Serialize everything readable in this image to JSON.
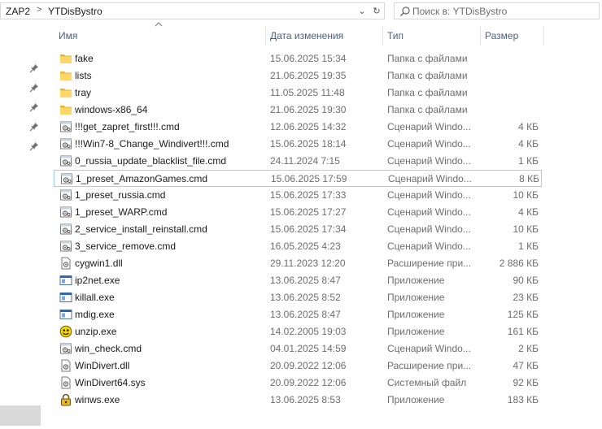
{
  "address": {
    "crumbs": [
      "ZAP2",
      "YTDisBystro"
    ],
    "separator": ">",
    "dropdown_glyph": "⌄",
    "refresh_glyph": "↻"
  },
  "search": {
    "placeholder": "Поиск в: YTDisBystro",
    "icon": "search-icon"
  },
  "columns": {
    "name": "Имя",
    "date": "Дата изменения",
    "type": "Тип",
    "size": "Размер",
    "sorted_by": "name",
    "sort_direction": "ascending"
  },
  "colors": {
    "folder": "#ffd766",
    "folder_dark": "#e8b43a",
    "selection_border": "#99d1ff",
    "header_text": "#4c607a",
    "secondary_text": "#6d6d6d"
  },
  "files": [
    {
      "name": "fake",
      "date": "15.06.2025 15:34",
      "type": "Папка с файлами",
      "size": "",
      "icon": "folder-icon"
    },
    {
      "name": "lists",
      "date": "21.06.2025 19:35",
      "type": "Папка с файлами",
      "size": "",
      "icon": "folder-icon"
    },
    {
      "name": "tray",
      "date": "11.05.2025 11:48",
      "type": "Папка с файлами",
      "size": "",
      "icon": "folder-icon"
    },
    {
      "name": "windows-x86_64",
      "date": "21.06.2025 19:30",
      "type": "Папка с файлами",
      "size": "",
      "icon": "folder-icon"
    },
    {
      "name": "!!!get_zapret_first!!!.cmd",
      "date": "12.06.2025 14:32",
      "type": "Сценарий Windo...",
      "size": "4 КБ",
      "icon": "script-icon"
    },
    {
      "name": "!!!Win7-8_Change_Windivert!!!.cmd",
      "date": "15.06.2025 18:14",
      "type": "Сценарий Windo...",
      "size": "4 КБ",
      "icon": "script-icon"
    },
    {
      "name": "0_russia_update_blacklist_file.cmd",
      "date": "24.11.2024 7:15",
      "type": "Сценарий Windo...",
      "size": "1 КБ",
      "icon": "script-icon"
    },
    {
      "name": "1_preset_AmazonGames.cmd",
      "date": "15.06.2025 17:59",
      "type": "Сценарий Windo...",
      "size": "8 КБ",
      "icon": "script-icon",
      "selected": true
    },
    {
      "name": "1_preset_russia.cmd",
      "date": "15.06.2025 17:33",
      "type": "Сценарий Windo...",
      "size": "10 КБ",
      "icon": "script-icon"
    },
    {
      "name": "1_preset_WARP.cmd",
      "date": "15.06.2025 17:27",
      "type": "Сценарий Windo...",
      "size": "4 КБ",
      "icon": "script-icon"
    },
    {
      "name": "2_service_install_reinstall.cmd",
      "date": "15.06.2025 17:34",
      "type": "Сценарий Windo...",
      "size": "10 КБ",
      "icon": "script-icon"
    },
    {
      "name": "3_service_remove.cmd",
      "date": "16.05.2025 4:23",
      "type": "Сценарий Windo...",
      "size": "1 КБ",
      "icon": "script-icon"
    },
    {
      "name": "cygwin1.dll",
      "date": "29.11.2023 12:20",
      "type": "Расширение при...",
      "size": "2 886 КБ",
      "icon": "dll-icon"
    },
    {
      "name": "ip2net.exe",
      "date": "13.06.2025 8:47",
      "type": "Приложение",
      "size": "90 КБ",
      "icon": "app-icon"
    },
    {
      "name": "killall.exe",
      "date": "13.06.2025 8:52",
      "type": "Приложение",
      "size": "23 КБ",
      "icon": "app-icon"
    },
    {
      "name": "mdig.exe",
      "date": "13.06.2025 8:47",
      "type": "Приложение",
      "size": "125 КБ",
      "icon": "app-icon"
    },
    {
      "name": "unzip.exe",
      "date": "14.02.2005 19:03",
      "type": "Приложение",
      "size": "161 КБ",
      "icon": "unzip-icon"
    },
    {
      "name": "win_check.cmd",
      "date": "04.01.2025 14:59",
      "type": "Сценарий Windo...",
      "size": "2 КБ",
      "icon": "script-icon"
    },
    {
      "name": "WinDivert.dll",
      "date": "20.09.2022 12:06",
      "type": "Расширение при...",
      "size": "47 КБ",
      "icon": "dll-icon"
    },
    {
      "name": "WinDivert64.sys",
      "date": "20.09.2022 12:06",
      "type": "Системный файл",
      "size": "92 КБ",
      "icon": "sys-icon"
    },
    {
      "name": "winws.exe",
      "date": "13.06.2025 8:53",
      "type": "Приложение",
      "size": "183 КБ",
      "icon": "winws-icon"
    }
  ]
}
